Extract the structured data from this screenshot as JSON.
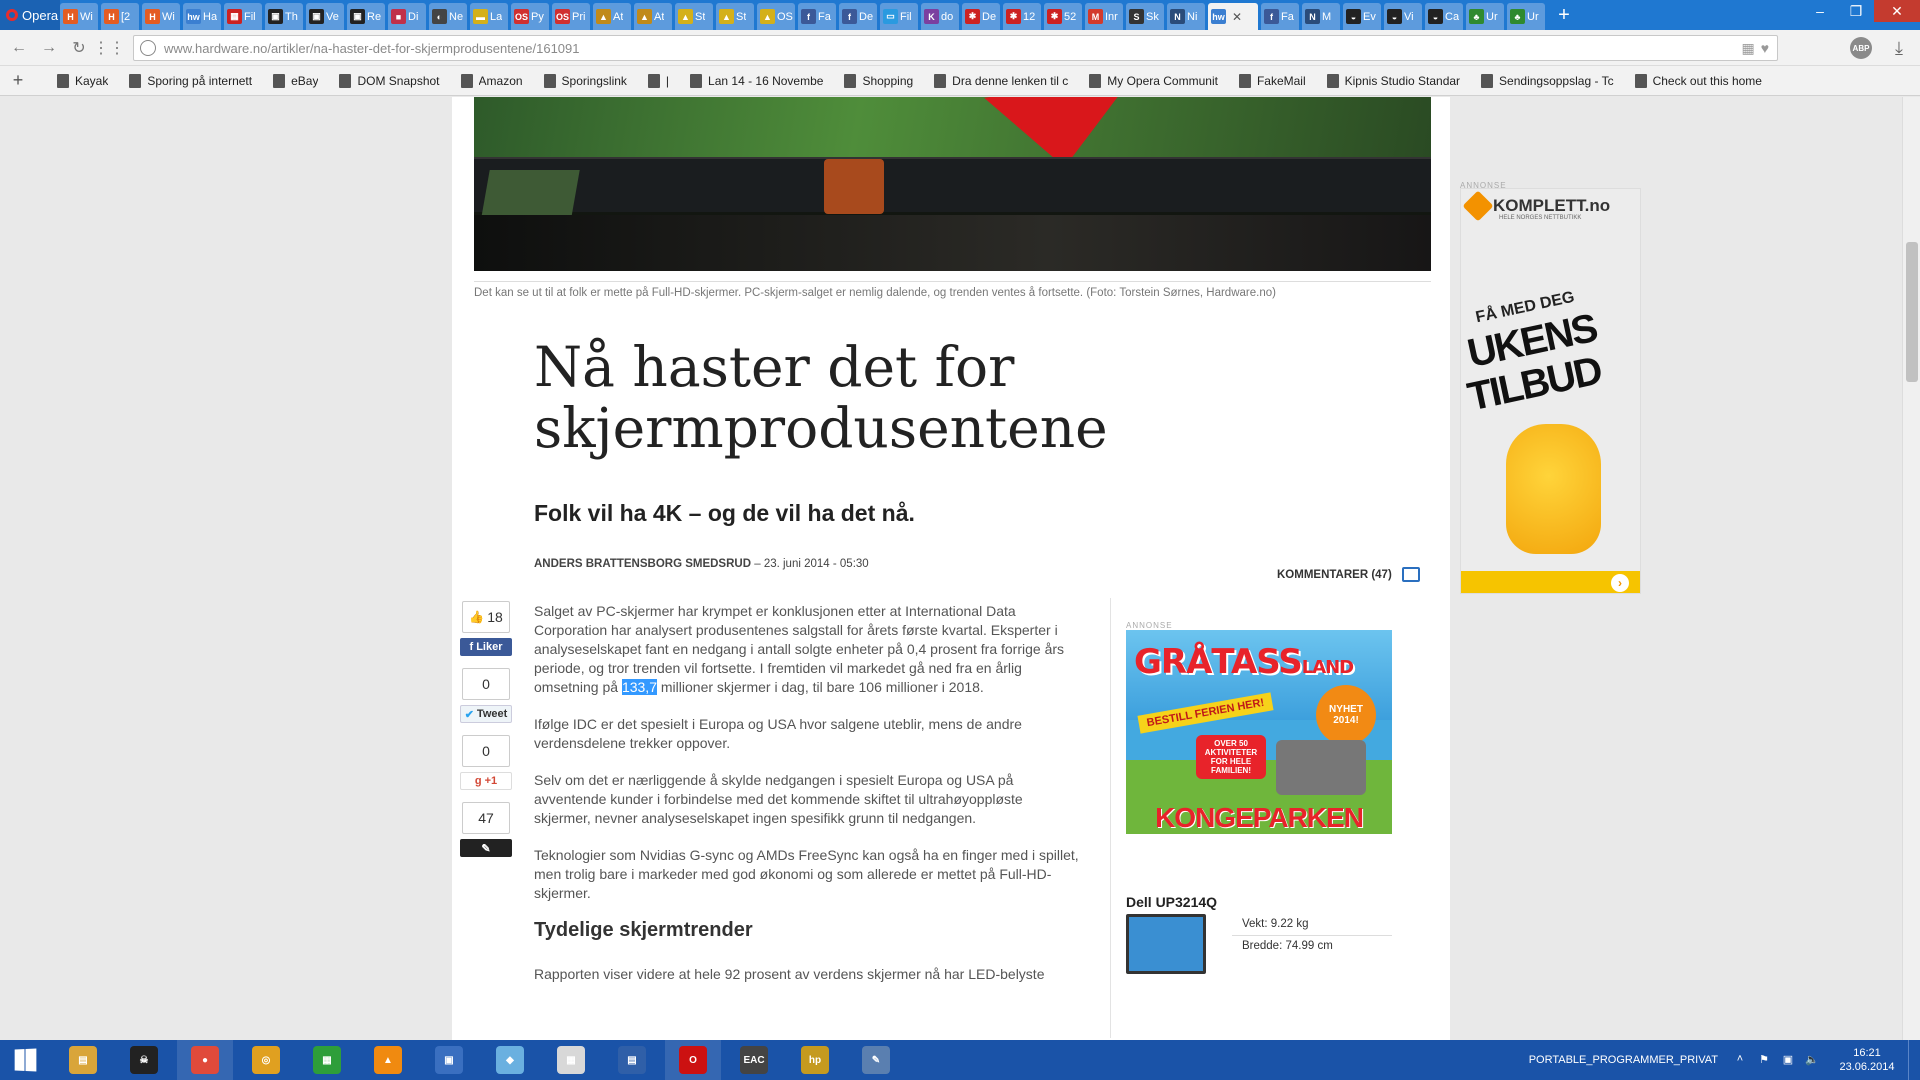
{
  "browser": {
    "menu_label": "Opera",
    "tabs": [
      {
        "title": "Wi",
        "color": "#e45c22",
        "glyph": "H"
      },
      {
        "title": "[2",
        "color": "#e45c22",
        "glyph": "H"
      },
      {
        "title": "Wi",
        "color": "#e45c22",
        "glyph": "H"
      },
      {
        "title": "Ha",
        "color": "#3b7fd1",
        "glyph": "hw"
      },
      {
        "title": "Fil",
        "color": "#cc2222",
        "glyph": "▦"
      },
      {
        "title": "Th",
        "color": "#222222",
        "glyph": "▣"
      },
      {
        "title": "Ve",
        "color": "#222222",
        "glyph": "▣"
      },
      {
        "title": "Re",
        "color": "#222222",
        "glyph": "▣"
      },
      {
        "title": "Di",
        "color": "#c0304a",
        "glyph": "■"
      },
      {
        "title": "Ne",
        "color": "#444444",
        "glyph": "◐"
      },
      {
        "title": "La",
        "color": "#d4b01a",
        "glyph": "▬"
      },
      {
        "title": "Py",
        "color": "#d03030",
        "glyph": "OS"
      },
      {
        "title": "Pri",
        "color": "#d03030",
        "glyph": "OS"
      },
      {
        "title": "At",
        "color": "#c08a1a",
        "glyph": "▲"
      },
      {
        "title": "At",
        "color": "#c08a1a",
        "glyph": "▲"
      },
      {
        "title": "St",
        "color": "#d4b01a",
        "glyph": "▲"
      },
      {
        "title": "St",
        "color": "#d4b01a",
        "glyph": "▲"
      },
      {
        "title": "OS",
        "color": "#d4b01a",
        "glyph": "▲"
      },
      {
        "title": "Fa",
        "color": "#3b5998",
        "glyph": "f"
      },
      {
        "title": "De",
        "color": "#3b5998",
        "glyph": "f"
      },
      {
        "title": "Fil",
        "color": "#2a9ae0",
        "glyph": "▭"
      },
      {
        "title": "do",
        "color": "#7b3fa0",
        "glyph": "K"
      },
      {
        "title": "De",
        "color": "#cc2222",
        "glyph": "✱"
      },
      {
        "title": "12",
        "color": "#cc2222",
        "glyph": "✱"
      },
      {
        "title": "52",
        "color": "#cc2222",
        "glyph": "✱"
      },
      {
        "title": "Inr",
        "color": "#d33a2c",
        "glyph": "M"
      },
      {
        "title": "Sk",
        "color": "#333333",
        "glyph": "S"
      },
      {
        "title": "Ni",
        "color": "#2a4c7a",
        "glyph": "N"
      },
      {
        "title": "",
        "color": "#3b7fd1",
        "glyph": "hw",
        "active": true
      },
      {
        "title": "Fa",
        "color": "#3b5998",
        "glyph": "f"
      },
      {
        "title": "M",
        "color": "#2a4c7a",
        "glyph": "N"
      },
      {
        "title": "Ev",
        "color": "#222222",
        "glyph": "◒"
      },
      {
        "title": "Vi",
        "color": "#222222",
        "glyph": "◒"
      },
      {
        "title": "Ca",
        "color": "#222222",
        "glyph": "◒"
      },
      {
        "title": "Ur",
        "color": "#2f8a2f",
        "glyph": "♣"
      },
      {
        "title": "Ur",
        "color": "#2f8a2f",
        "glyph": "♣"
      }
    ],
    "url": "www.hardware.no/artikler/na-haster-det-for-skjermprodusentene/161091",
    "abp_label": "ABP",
    "bookmarks": [
      "Kayak",
      "Sporing på internett",
      "eBay",
      "DOM Snapshot",
      "Amazon",
      "Sporingslink",
      "|",
      "Lan 14 - 16 Novembe",
      "Shopping",
      "Dra denne lenken til c",
      "My Opera Communit",
      "FakeMail",
      "Kipnis Studio Standar",
      "Sendingsoppslag - Tc",
      "Check out this home"
    ]
  },
  "article": {
    "caption": "Det kan se ut til at folk er mette på Full-HD-skjermer. PC-skjerm-salget er nemlig dalende, og trenden ventes å fortsette.",
    "caption_credit": "(Foto: Torstein Sørnes, Hardware.no)",
    "headline": "Nå haster det for skjermprodusentene",
    "subhead": "Folk vil ha 4K – og de vil ha det nå.",
    "author": "ANDERS BRATTENSBORG SMEDSRUD",
    "date": "– 23. juni 2014 - 05:30",
    "comments_label": "KOMMENTARER (47)",
    "p1_before": "Salget av PC-skjermer har krympet er konklusjonen etter at International Data Corporation har analysert produsentenes salgstall for årets første kvartal. Eksperter i analyseselskapet fant en nedgang i antall solgte enheter på 0,4 prosent fra forrige års periode, og tror trenden vil fortsette. I fremtiden vil markedet gå ned fra en årlig omsetning på ",
    "p1_highlight": "133,7",
    "p1_after": " millioner skjermer i dag, til bare 106 millioner i 2018.",
    "p2": "Ifølge IDC er det spesielt i Europa og USA hvor salgene uteblir, mens de andre verdensdelene trekker oppover.",
    "p3": "Selv om det er nærliggende å skylde nedgangen i spesielt Europa og USA på avventende kunder i forbindelse med det kommende skiftet til ultrahøyoppløste skjermer, nevner analyseselskapet ingen spesifikk grunn til nedgangen.",
    "p4": "Teknologier som Nvidias G-sync og AMDs FreeSync kan også ha en finger med i spillet, men trolig bare i markeder med god økonomi og som allerede er mettet på Full-HD-skjermer.",
    "h2": "Tydelige skjermtrender",
    "p5": "Rapporten viser videre at hele 92 prosent av verdens skjermer nå har LED-belyste"
  },
  "social": {
    "fb_count": "18",
    "fb_label": "Liker",
    "tweet_count": "0",
    "tweet_label": "Tweet",
    "gplus_count": "0",
    "gplus_label": "+1",
    "comment_count": "47"
  },
  "sidebar": {
    "ad_label": "ANNONSE",
    "ad2_title": "GRÅTASS",
    "ad2_title_suffix": "LAND",
    "ad2_banner": "BESTILL FERIEN HER!",
    "ad2_nyhet": "NYHET",
    "ad2_year": "2014!",
    "ad2_heart": "OVER 50 AKTIVITETER FOR HELE FAMILIEN!",
    "ad2_bottom": "KONGEPARKEN",
    "product_title": "Dell UP3214Q",
    "product_weight": "Vekt: 9.22 kg",
    "product_width": "Bredde: 74.99 cm"
  },
  "right_ad": {
    "label": "ANNONSE",
    "brand": "KOMPLETT.no",
    "tagline": "HELE NORGES NETTBUTIKK",
    "fa": "FÅ MED DEG",
    "ukens": "UKENS",
    "tilbud": "TILBUD"
  },
  "taskbar": {
    "apps": [
      {
        "label": "",
        "color": "#d9a53a",
        "glyph": "▤"
      },
      {
        "label": "",
        "color": "#222222",
        "glyph": "☠"
      },
      {
        "label": "",
        "color": "#e04a3a",
        "glyph": "●",
        "running": true
      },
      {
        "label": "",
        "color": "#e0a020",
        "glyph": "◎"
      },
      {
        "label": "",
        "color": "#2e9e3a",
        "glyph": "▦"
      },
      {
        "label": "",
        "color": "#f08a10",
        "glyph": "▲"
      },
      {
        "label": "",
        "color": "#3a6fc0",
        "glyph": "▣"
      },
      {
        "label": "",
        "color": "#6ab0e0",
        "glyph": "◆"
      },
      {
        "label": "",
        "color": "#d8d8d8",
        "glyph": "▦"
      },
      {
        "label": "",
        "color": "#2f5fa8",
        "glyph": "▤"
      },
      {
        "label": "",
        "color": "#cc1111",
        "glyph": "O",
        "running": true
      },
      {
        "label": "EAC",
        "color": "#444444",
        "glyph": "EAC"
      },
      {
        "label": "",
        "color": "#c59a1f",
        "glyph": "hp"
      },
      {
        "label": "",
        "color": "#5a7fb0",
        "glyph": "✎"
      }
    ],
    "tray_label": "PORTABLE_PROGRAMMER_PRIVAT",
    "time": "16:21",
    "date": "23.06.2014"
  }
}
